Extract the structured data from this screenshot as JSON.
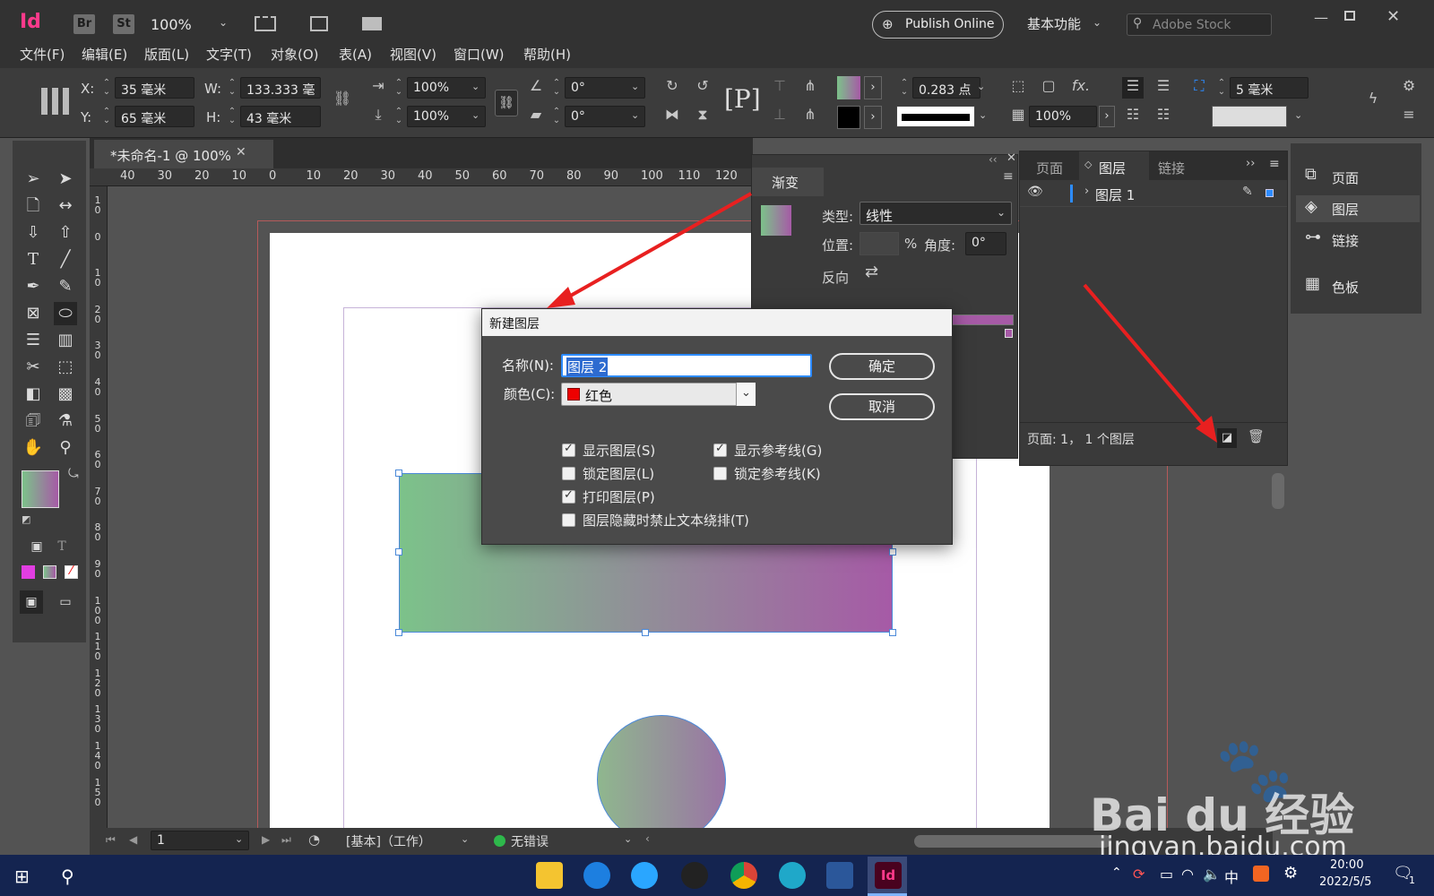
{
  "app": {
    "logo": "Id",
    "br": "Br",
    "st": "St",
    "zoom": "100%",
    "publish_online": "Publish Online",
    "workspace": "基本功能",
    "search_placeholder": "Adobe Stock"
  },
  "menu": [
    "文件(F)",
    "编辑(E)",
    "版面(L)",
    "文字(T)",
    "对象(O)",
    "表(A)",
    "视图(V)",
    "窗口(W)",
    "帮助(H)"
  ],
  "control": {
    "x_label": "X:",
    "x_value": "35 毫米",
    "y_label": "Y:",
    "y_value": "65 毫米",
    "w_label": "W:",
    "w_value": "133.333 毫",
    "h_label": "H:",
    "h_value": "43 毫米",
    "scale_x": "100%",
    "scale_y": "100%",
    "rotate": "0°",
    "shear": "0°",
    "stroke_weight": "0.283 点",
    "opacity": "100%",
    "offset": "5 毫米"
  },
  "document": {
    "tab_title": "*未命名-1 @ 100%",
    "ruler_h": [
      "40",
      "30",
      "20",
      "10",
      "0",
      "10",
      "20",
      "30",
      "40",
      "50",
      "60",
      "70",
      "80",
      "90",
      "100",
      "110",
      "120"
    ],
    "ruler_v": [
      "1\n0",
      "0",
      "1\n0",
      "2\n0",
      "3\n0",
      "4\n0",
      "5\n0",
      "6\n0",
      "7\n0",
      "8\n0",
      "9\n0",
      "1\n0\n0",
      "1\n1\n0",
      "1\n2\n0",
      "1\n3\n0",
      "1\n4\n0",
      "1\n5\n0"
    ]
  },
  "gradient_panel": {
    "title": "渐变",
    "type_label": "类型:",
    "type_value": "线性",
    "position_label": "位置:",
    "percent": "%",
    "angle_label": "角度:",
    "angle_value": "0°",
    "reverse_label": "反向"
  },
  "layers_panel": {
    "tabs": [
      "页面",
      "图层",
      "链接"
    ],
    "layer1": "图层 1",
    "footer": "页面: 1， 1 个图层"
  },
  "right_dock": [
    "页面",
    "图层",
    "链接",
    "色板"
  ],
  "status": {
    "page": "1",
    "style": "[基本]（工作）",
    "preflight": "无错误"
  },
  "dialog": {
    "title": "新建图层",
    "name_label": "名称(N):",
    "name_value": "图层 2",
    "color_label": "颜色(C):",
    "color_value": "红色",
    "ok": "确定",
    "cancel": "取消",
    "checks": [
      {
        "label": "显示图层(S)",
        "checked": true
      },
      {
        "label": "显示参考线(G)",
        "checked": true
      },
      {
        "label": "锁定图层(L)",
        "checked": false
      },
      {
        "label": "锁定参考线(K)",
        "checked": false
      },
      {
        "label": "打印图层(P)",
        "checked": true
      },
      {
        "label": "图层隐藏时禁止文本绕排(T)",
        "checked": false
      }
    ]
  },
  "taskbar": {
    "time": "20:00",
    "date": "2022/5/5",
    "ime": "中",
    "notif_count": "1"
  },
  "watermark": {
    "brand": "Bai du 经验",
    "url": "jingyan.baidu.com"
  },
  "colors": {
    "accent": "#2d8cff",
    "indesign": "#ff3366",
    "layer_red": "#ee0000",
    "gradient_start": "#7cc28a",
    "gradient_end": "#a65aa6",
    "arrow": "#e82020"
  }
}
